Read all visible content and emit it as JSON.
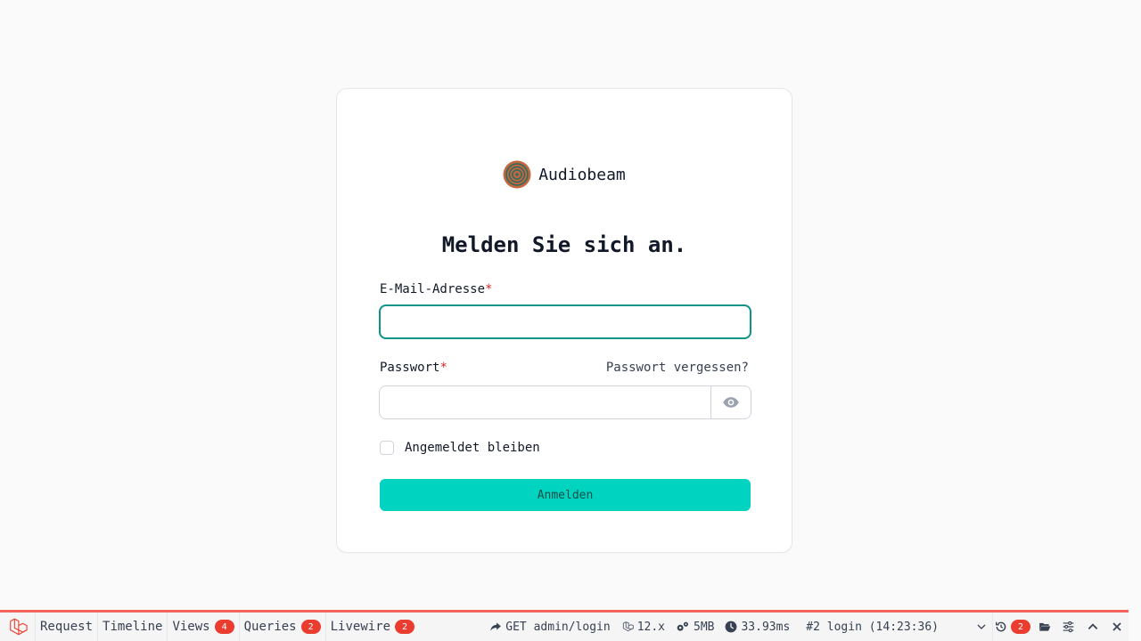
{
  "brand": {
    "name": "Audiobeam",
    "logo_icon": "audiobeam-logo-icon"
  },
  "form": {
    "heading": "Melden Sie sich an.",
    "email_label": "E-Mail-Adresse",
    "password_label": "Passwort",
    "required_mark": "*",
    "forgot_link": "Passwort vergessen?",
    "remember_label": "Angemeldet bleiben",
    "submit_label": "Anmelden"
  },
  "debugbar": {
    "tabs": [
      {
        "label": "Request"
      },
      {
        "label": "Timeline"
      },
      {
        "label": "Views",
        "count": "4"
      },
      {
        "label": "Queries",
        "count": "2"
      },
      {
        "label": "Livewire",
        "count": "2"
      }
    ],
    "method_route": "GET admin/login",
    "version": "12.x",
    "memory": "5MB",
    "duration": "33.93ms",
    "request_select": "#2 login (14:23:36)",
    "history_count": "2"
  },
  "colors": {
    "accent": "#00d4c0",
    "focus_border": "#0d9488",
    "required": "#dc2626",
    "debugbar_accent": "#f4645f",
    "badge": "#ea3d2f"
  }
}
